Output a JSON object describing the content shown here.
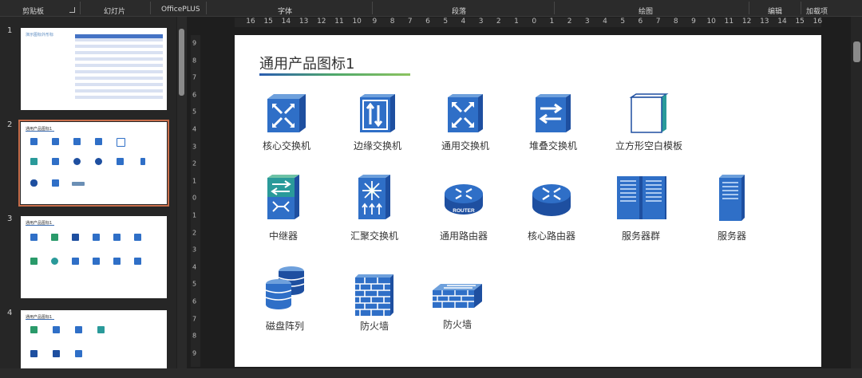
{
  "ribbon": {
    "groups": [
      "剪贴板",
      "幻灯片",
      "OfficePLUS",
      "字体",
      "段落",
      "绘图",
      "编辑",
      "加载项"
    ]
  },
  "thumbnails": {
    "numbers": [
      "1",
      "2",
      "3",
      "4"
    ],
    "slide1_title": "演示图标外形标",
    "slide_title": "通用产品图标1"
  },
  "ruler": {
    "horizontal": [
      "16",
      "15",
      "14",
      "13",
      "12",
      "11",
      "10",
      "9",
      "8",
      "7",
      "6",
      "5",
      "4",
      "3",
      "2",
      "1",
      "0",
      "1",
      "2",
      "3",
      "4",
      "5",
      "6",
      "7",
      "8",
      "9",
      "10",
      "11",
      "12",
      "13",
      "14",
      "15",
      "16"
    ],
    "vertical": [
      "9",
      "8",
      "7",
      "6",
      "5",
      "4",
      "3",
      "2",
      "1",
      "0",
      "1",
      "2",
      "3",
      "4",
      "5",
      "6",
      "7",
      "8",
      "9"
    ]
  },
  "slide": {
    "title": "通用产品图标1",
    "icons": [
      {
        "label": "核心交换机",
        "icon": "core-switch-icon"
      },
      {
        "label": "边缘交换机",
        "icon": "edge-switch-icon"
      },
      {
        "label": "通用交换机",
        "icon": "generic-switch-icon"
      },
      {
        "label": "堆叠交换机",
        "icon": "stack-switch-icon"
      },
      {
        "label": "立方形空白模板",
        "icon": "blank-cube-icon"
      },
      {
        "label": "中继器",
        "icon": "repeater-icon"
      },
      {
        "label": "汇聚交换机",
        "icon": "aggregation-switch-icon"
      },
      {
        "label": "通用路由器",
        "icon": "router-icon"
      },
      {
        "label": "核心路由器",
        "icon": "core-router-icon"
      },
      {
        "label": "服务器群",
        "icon": "server-farm-icon"
      },
      {
        "label": "服务器",
        "icon": "server-icon"
      },
      {
        "label": "磁盘阵列",
        "icon": "disk-array-icon"
      },
      {
        "label": "防火墙",
        "icon": "firewall-icon"
      },
      {
        "label": "防火墙",
        "icon": "firewall-flat-icon"
      }
    ],
    "router_text": "ROUTER"
  },
  "colors": {
    "accent_dark": "#1e4fa0",
    "accent_mid": "#2f6fc7",
    "accent_teal": "#2a9a9a",
    "selection": "#c86e4b"
  }
}
